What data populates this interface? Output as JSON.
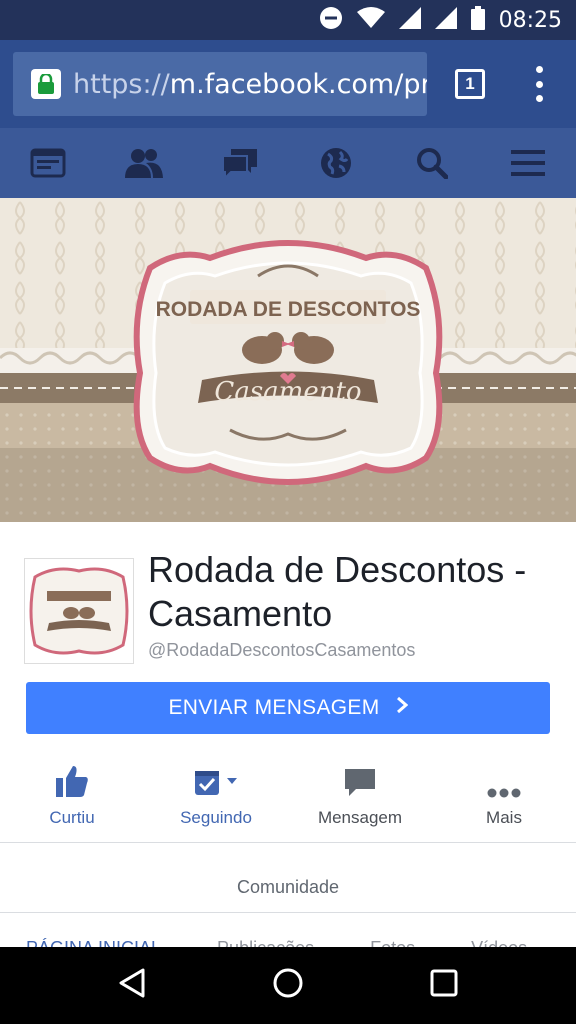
{
  "status_bar": {
    "time": "08:25"
  },
  "browser": {
    "url_prefix": "https://",
    "url_host": "m.facebook.com/pro",
    "tab_count": "1"
  },
  "fb_nav": {
    "items": [
      "feed-icon",
      "friends-icon",
      "messages-icon",
      "globe-icon",
      "search-icon",
      "menu-icon"
    ]
  },
  "cover": {
    "logo_title": "RODADA DE DESCONTOS",
    "logo_script": "Casamento"
  },
  "page": {
    "title": "Rodada de Descontos - Casamento",
    "username": "@RodadaDescontosCasamentos",
    "send_message_label": "ENVIAR MENSAGEM"
  },
  "actions": [
    {
      "label": "Curtiu",
      "icon": "thumbs-up-icon"
    },
    {
      "label": "Seguindo",
      "icon": "following-icon"
    },
    {
      "label": "Mensagem",
      "icon": "message-bubble-icon"
    },
    {
      "label": "Mais",
      "icon": "more-dots-icon"
    }
  ],
  "community_label": "Comunidade",
  "tabs": [
    "PÁGINA INICIAL",
    "Publicações",
    "Fotos",
    "Vídeos"
  ],
  "colors": {
    "fb_blue": "#3b5998",
    "button_blue": "#4080ff",
    "link_blue": "#4267b2"
  }
}
